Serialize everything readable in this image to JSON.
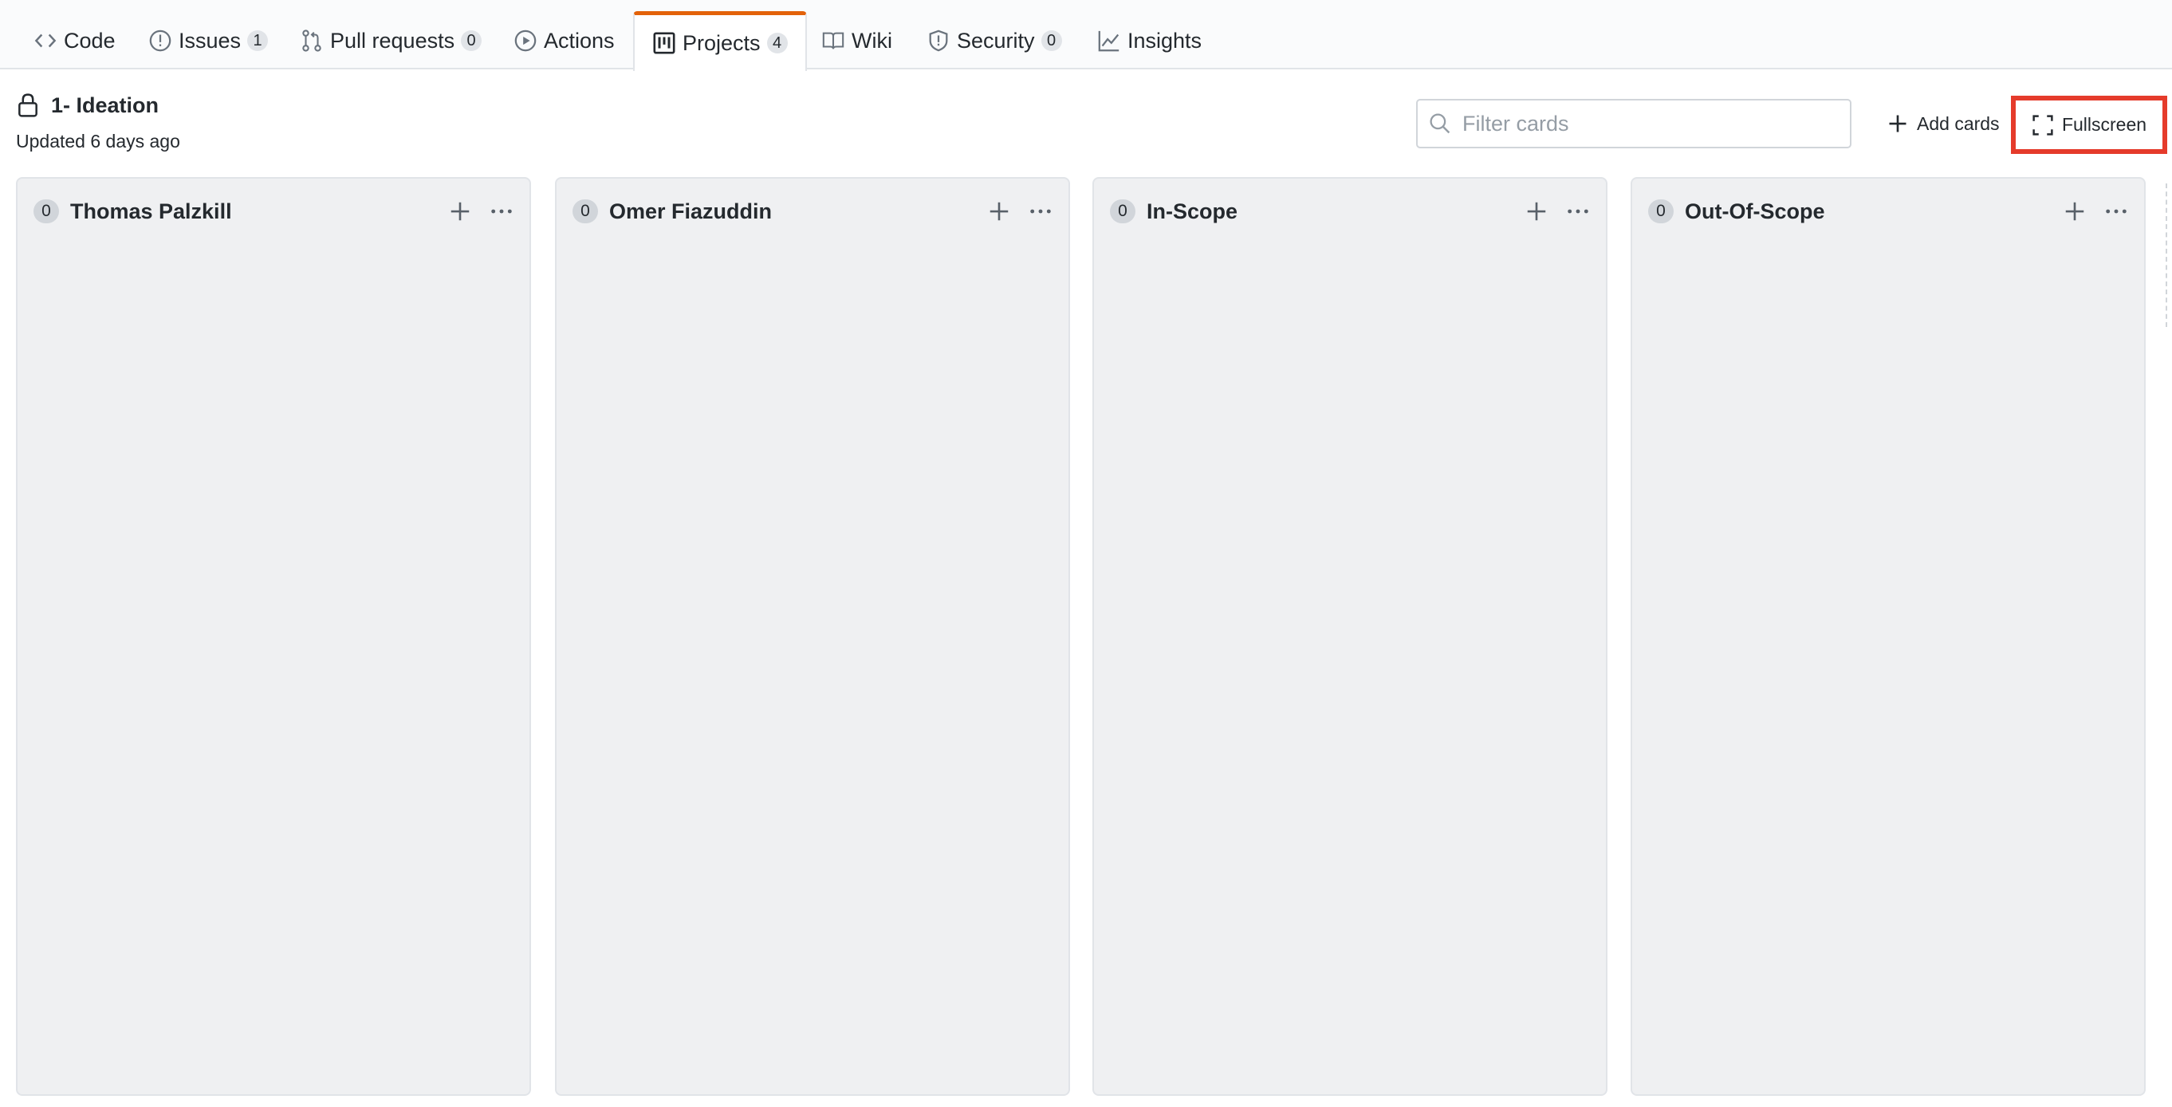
{
  "nav": {
    "tabs": [
      {
        "label": "Code",
        "icon": "code-icon"
      },
      {
        "label": "Issues",
        "icon": "issue-icon",
        "count": "1"
      },
      {
        "label": "Pull requests",
        "icon": "pull-request-icon",
        "count": "0"
      },
      {
        "label": "Actions",
        "icon": "play-icon"
      },
      {
        "label": "Projects",
        "icon": "project-icon",
        "count": "4",
        "selected": true
      },
      {
        "label": "Wiki",
        "icon": "book-icon"
      },
      {
        "label": "Security",
        "icon": "shield-icon",
        "count": "0"
      },
      {
        "label": "Insights",
        "icon": "graph-icon"
      }
    ]
  },
  "project": {
    "title": "1- Ideation",
    "updated": "Updated 6 days ago"
  },
  "toolbar": {
    "filter_placeholder": "Filter cards",
    "add_cards_label": "Add cards",
    "fullscreen_label": "Fullscreen"
  },
  "columns": [
    {
      "name": "Thomas Palzkill",
      "count": "0"
    },
    {
      "name": "Omer Fiazuddin",
      "count": "0"
    },
    {
      "name": "In-Scope",
      "count": "0"
    },
    {
      "name": "Out-Of-Scope",
      "count": "0"
    }
  ],
  "colors": {
    "selected_tab_accent": "#e36209",
    "highlight_box": "#e53b2b",
    "column_bg": "#eff0f2"
  }
}
